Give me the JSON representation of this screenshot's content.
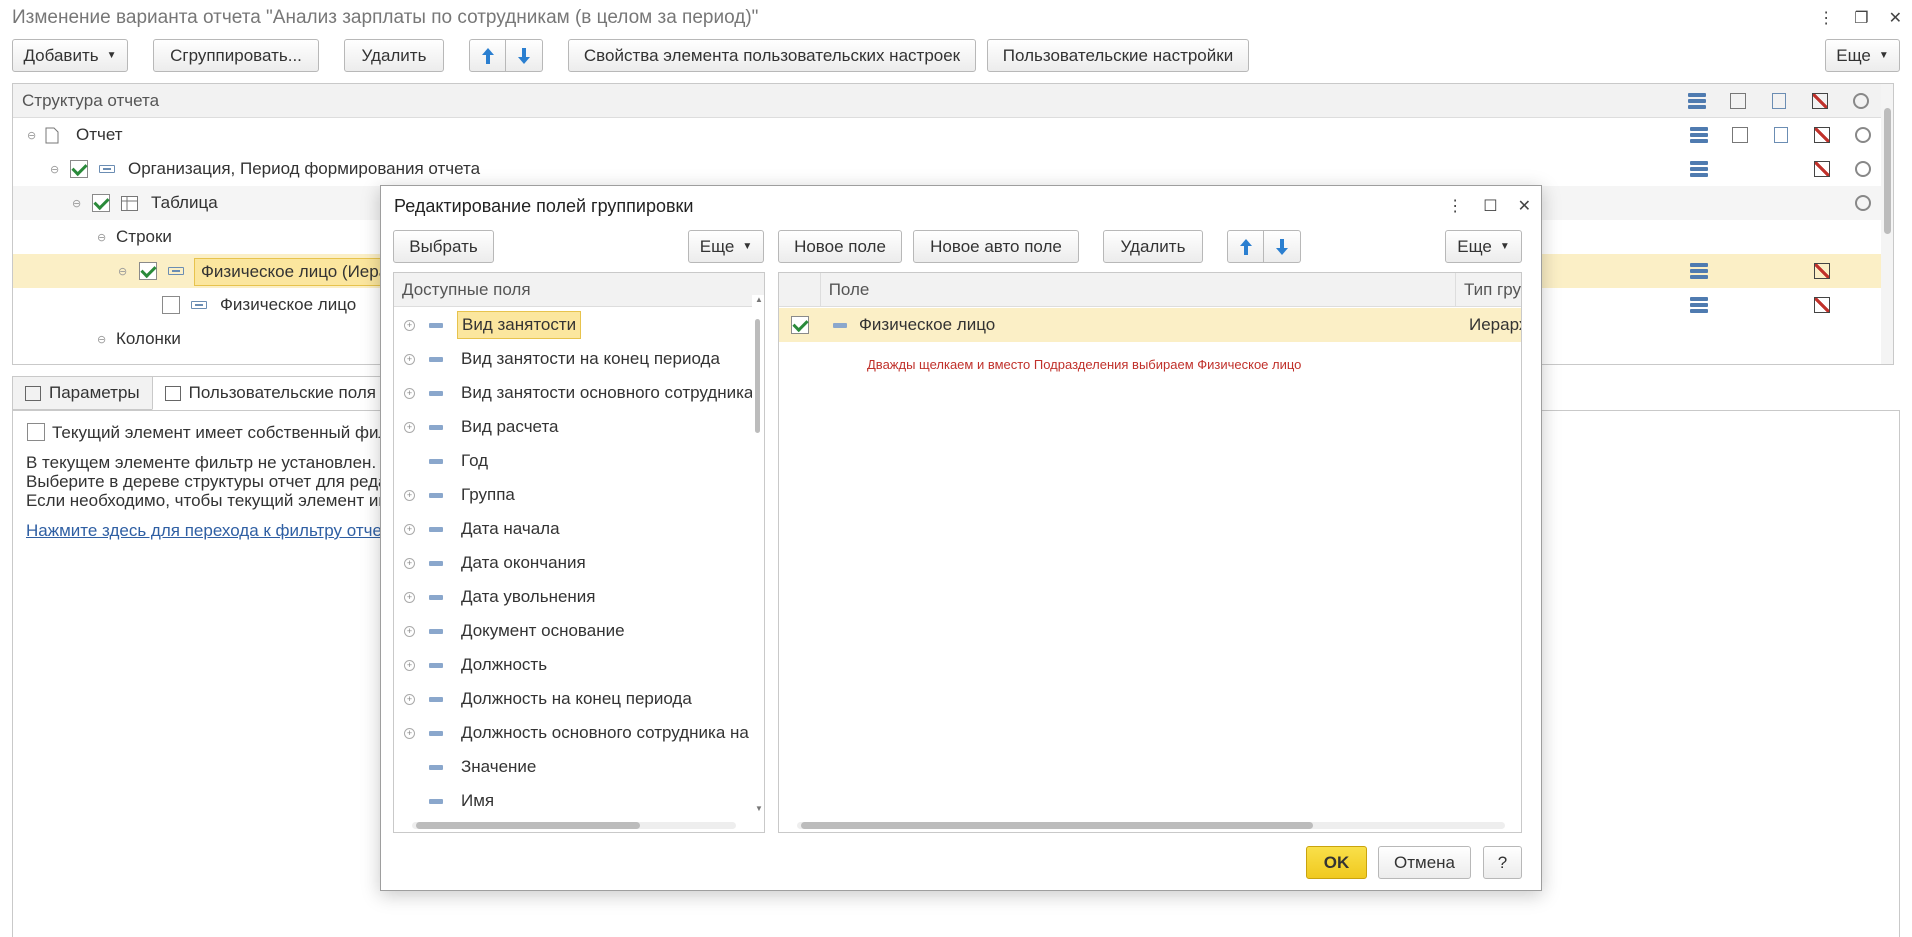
{
  "window": {
    "title": "Изменение варианта отчета \"Анализ зарплаты по сотрудникам (в целом за период)\""
  },
  "toolbar": {
    "add_label": "Добавить",
    "group_label": "Сгруппировать...",
    "delete_label": "Удалить",
    "element_props_label": "Свойства элемента пользовательских настроек",
    "user_settings_label": "Пользовательские настройки",
    "more_label": "Еще"
  },
  "structure": {
    "header": "Структура отчета",
    "rows": [
      {
        "label": "Отчет"
      },
      {
        "label": "Организация, Период формирования отчета"
      },
      {
        "label": "Таблица"
      },
      {
        "label": "Строки"
      },
      {
        "label": "Физическое лицо (Иера"
      },
      {
        "label": "Физическое лицо"
      },
      {
        "label": "Колонки"
      }
    ]
  },
  "tabs": [
    {
      "label": "Параметры"
    },
    {
      "label": "Пользовательские поля"
    }
  ],
  "bottom": {
    "own_filter_label": "Текущий элемент имеет собственный фил",
    "line1": "В текущем элементе фильтр не установлен.",
    "line2": "Выберите в дереве структуры отчет для реда",
    "line3": "Если необходимо, чтобы текущий элемент им",
    "link": "Нажмите здесь для перехода к фильтру отчет"
  },
  "dialog": {
    "title": "Редактирование полей группировки",
    "select_label": "Выбрать",
    "more_label": "Еще",
    "new_field_label": "Новое поле",
    "new_auto_field_label": "Новое авто поле",
    "delete_label": "Удалить",
    "available_header": "Доступные поля",
    "available_fields": [
      {
        "label": "Вид занятости",
        "expandable": true
      },
      {
        "label": "Вид занятости на конец периода",
        "expandable": true
      },
      {
        "label": "Вид занятости основного сотрудника",
        "expandable": true
      },
      {
        "label": "Вид расчета",
        "expandable": true
      },
      {
        "label": "Год",
        "expandable": false
      },
      {
        "label": "Группа",
        "expandable": true
      },
      {
        "label": "Дата начала",
        "expandable": true
      },
      {
        "label": "Дата окончания",
        "expandable": true
      },
      {
        "label": "Дата увольнения",
        "expandable": true
      },
      {
        "label": "Документ основание",
        "expandable": true
      },
      {
        "label": "Должность",
        "expandable": true
      },
      {
        "label": "Должность на конец периода",
        "expandable": true
      },
      {
        "label": "Должность основного сотрудника на к",
        "expandable": true
      },
      {
        "label": "Значение",
        "expandable": false
      },
      {
        "label": "Имя",
        "expandable": false
      }
    ],
    "selected_columns": {
      "field": "Поле",
      "type": "Тип гру"
    },
    "selected_row": {
      "field": "Физическое лицо",
      "type": "Иерарх"
    },
    "annotation": "Дважды щелкаем и вместо Подразделения выбираем Физическое лицо",
    "ok_label": "OK",
    "cancel_label": "Отмена",
    "help_label": "?"
  },
  "colors": {
    "accent_yellow": "#f0c91f",
    "selection": "#fbefc6",
    "annotation_red": "#c0312b",
    "arrow_blue": "#2b7fd0"
  }
}
